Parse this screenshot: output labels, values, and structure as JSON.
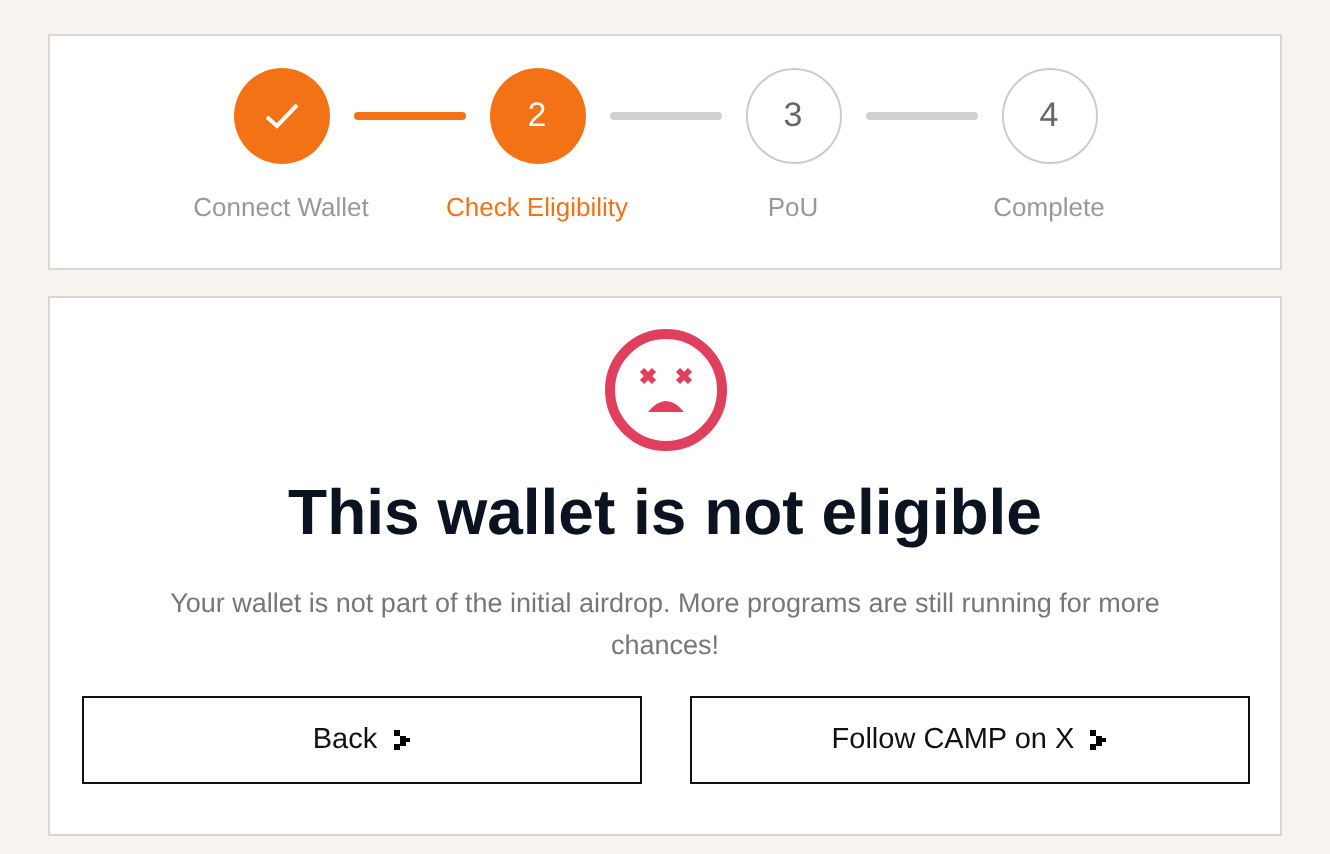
{
  "steps": [
    {
      "label": "Connect Wallet",
      "kind": "done"
    },
    {
      "number": "2",
      "label": "Check Eligibility",
      "kind": "active"
    },
    {
      "number": "3",
      "label": "PoU",
      "kind": "pending"
    },
    {
      "number": "4",
      "label": "Complete",
      "kind": "pending"
    }
  ],
  "result": {
    "title": "This wallet is not eligible",
    "message": "Your wallet is not part of the initial airdrop. More programs are still running for more chances!"
  },
  "buttons": [
    "Back",
    "Follow CAMP on X"
  ]
}
